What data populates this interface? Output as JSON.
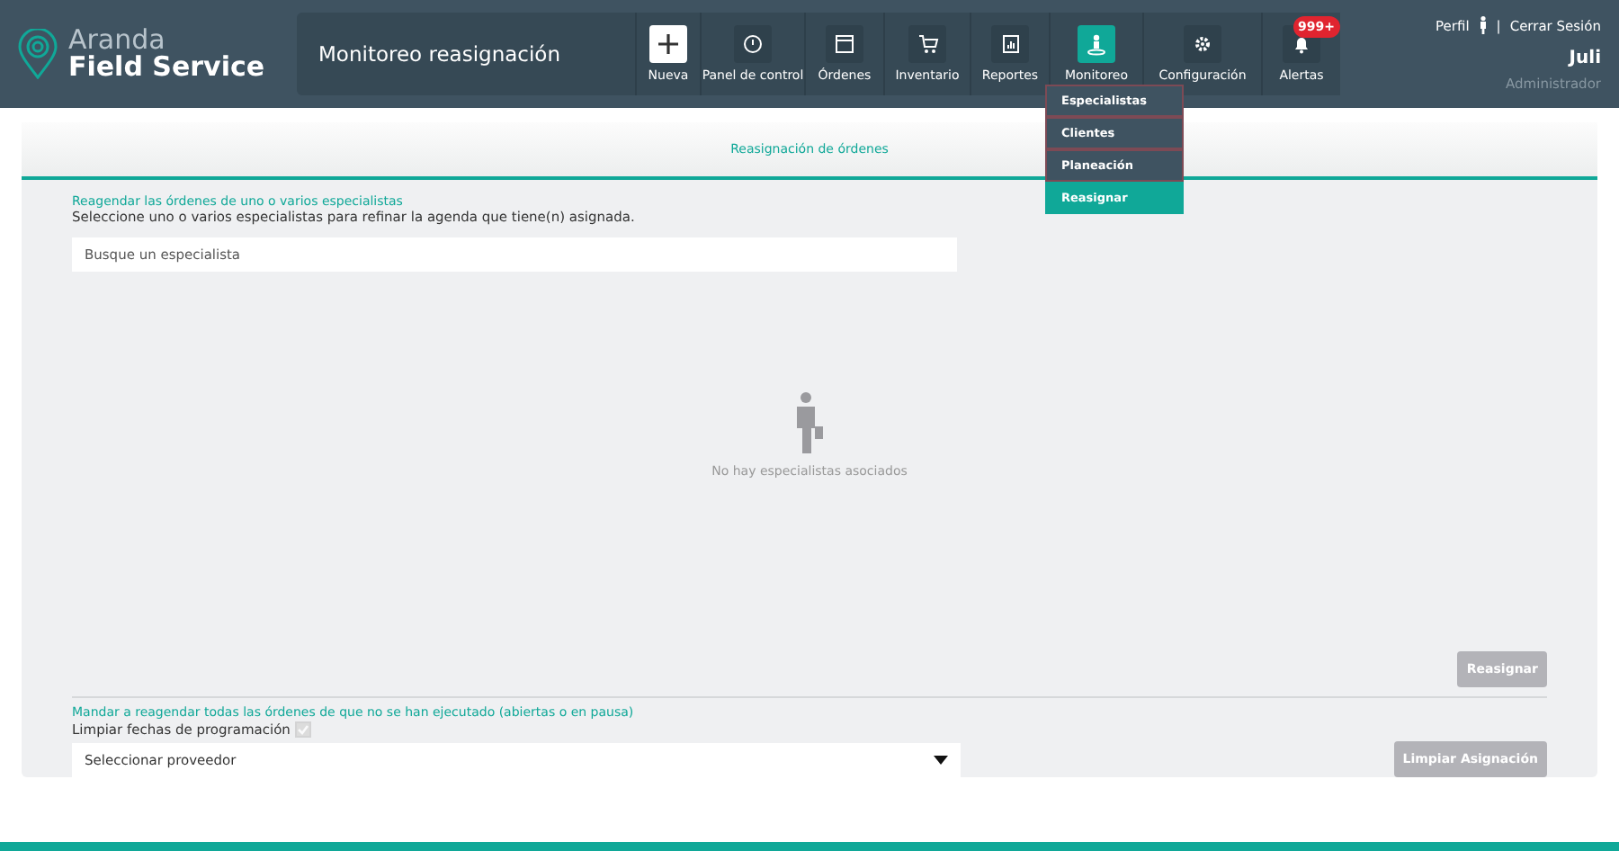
{
  "header": {
    "brand_top": "Aranda",
    "brand_bottom": "Field Service",
    "page_title": "Monitoreo reasignación",
    "nav": [
      {
        "label": "Nueva",
        "kind": "action",
        "selected": false
      },
      {
        "label": "Panel de control",
        "kind": "gauge",
        "selected": false
      },
      {
        "label": "Órdenes",
        "kind": "window",
        "selected": false
      },
      {
        "label": "Inventario",
        "kind": "cart",
        "selected": false
      },
      {
        "label": "Reportes",
        "kind": "report",
        "selected": false
      },
      {
        "label": "Monitoreo",
        "kind": "person",
        "selected": true,
        "menu": [
          {
            "label": "Especialistas",
            "selected": false
          },
          {
            "label": "Clientes",
            "selected": false
          },
          {
            "label": "Planeación",
            "selected": false
          },
          {
            "label": "Reasignar",
            "selected": true
          }
        ]
      },
      {
        "label": "Configuración",
        "kind": "gear",
        "selected": false
      },
      {
        "label": "Alertas",
        "kind": "bell",
        "selected": false,
        "badge": "999+"
      }
    ],
    "profile": "Perfil",
    "separator": "|",
    "logout": "Cerrar Sesión",
    "user": "Juli",
    "role": "Administrador"
  },
  "card": {
    "title": "Reasignación de órdenes",
    "section_title": "Reagendar las órdenes de uno o varios especialistas",
    "section_hint": "Seleccione uno o varios especialistas para refinar la agenda que tiene(n) asignada.",
    "search": {
      "placeholder": "Busque un especialista"
    },
    "empty_text": "No hay especialistas asociados",
    "reassign_button": {
      "label": "Reasignar",
      "disabled": true
    },
    "bulk_title": "Mandar a reagendar todas las órdenes de que no se han ejecutado (abiertas o en pausa)",
    "clear_dates": {
      "label": "Limpiar fechas de programación",
      "checked": true,
      "disabled": true
    },
    "provider_select": {
      "value": "Seleccionar proveedor"
    },
    "clear_button": {
      "label": "Limpiar Asignación",
      "disabled": true
    }
  }
}
